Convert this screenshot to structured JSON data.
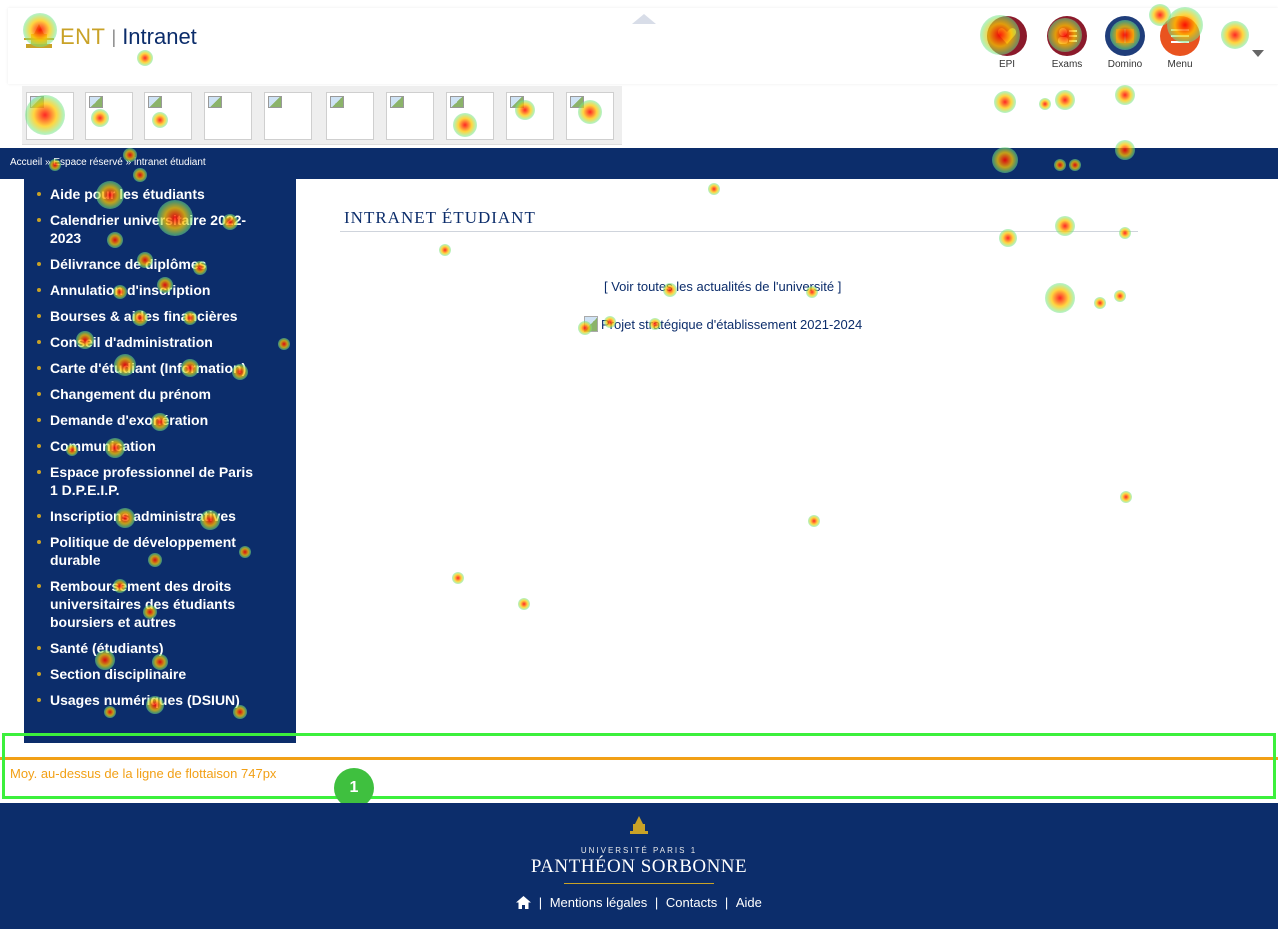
{
  "header": {
    "logo_text": "ENT",
    "logo_sep": "|",
    "site_name": "Intranet",
    "apps": [
      {
        "label": "EPI",
        "icon": "heart-icon",
        "color": "#8b1a2b"
      },
      {
        "label": "Exams",
        "icon": "exams-icon",
        "color": "#8b1a2b"
      },
      {
        "label": "Domino",
        "icon": "book-icon",
        "color": "#1f3d7a"
      },
      {
        "label": "Menu",
        "icon": "menu-icon",
        "color": "#e9531f"
      }
    ]
  },
  "breadcrumb": {
    "items": [
      "Accueil",
      "Espace réservé",
      "intranet étudiant"
    ],
    "sep": " » "
  },
  "sidebar": {
    "items": [
      "Aide pour les étudiants",
      "Calendrier universitaire 2022-2023",
      "Délivrance de diplômes",
      "Annulation d'inscription",
      "Bourses & aides financières",
      "Conseil d'administration",
      "Carte d'étudiant (Information)",
      "Changement du prénom",
      "Demande d'exonération",
      "Communication",
      "Espace professionnel de Paris 1 D.P.E.I.P.",
      "Inscriptions administratives",
      "Politique de développement durable",
      "Remboursement des droits universitaires des étudiants boursiers et autres",
      "Santé (étudiants)",
      "Section disciplinaire",
      "Usages numériques (DSIUN)"
    ]
  },
  "main": {
    "title": "INTRANET ÉTUDIANT",
    "news_link": "[ Voir toutes les actualités de l'université ]",
    "strategic_link": "Projet stratégique d'établissement 2021-2024"
  },
  "fold": {
    "text": "Moy. au-dessus de la ligne de flottaison 747px",
    "badge": "1"
  },
  "footer": {
    "university_sub": "UNIVERSITÉ PARIS 1",
    "university_name": "PANTHÉON SORBONNE",
    "links": [
      "Mentions légales",
      "Contacts",
      "Aide"
    ],
    "sep": "|"
  },
  "colors": {
    "navy": "#0c2d6b",
    "gold": "#c9a227",
    "fold_line": "#f2a016",
    "highlight": "#3cf03c"
  }
}
